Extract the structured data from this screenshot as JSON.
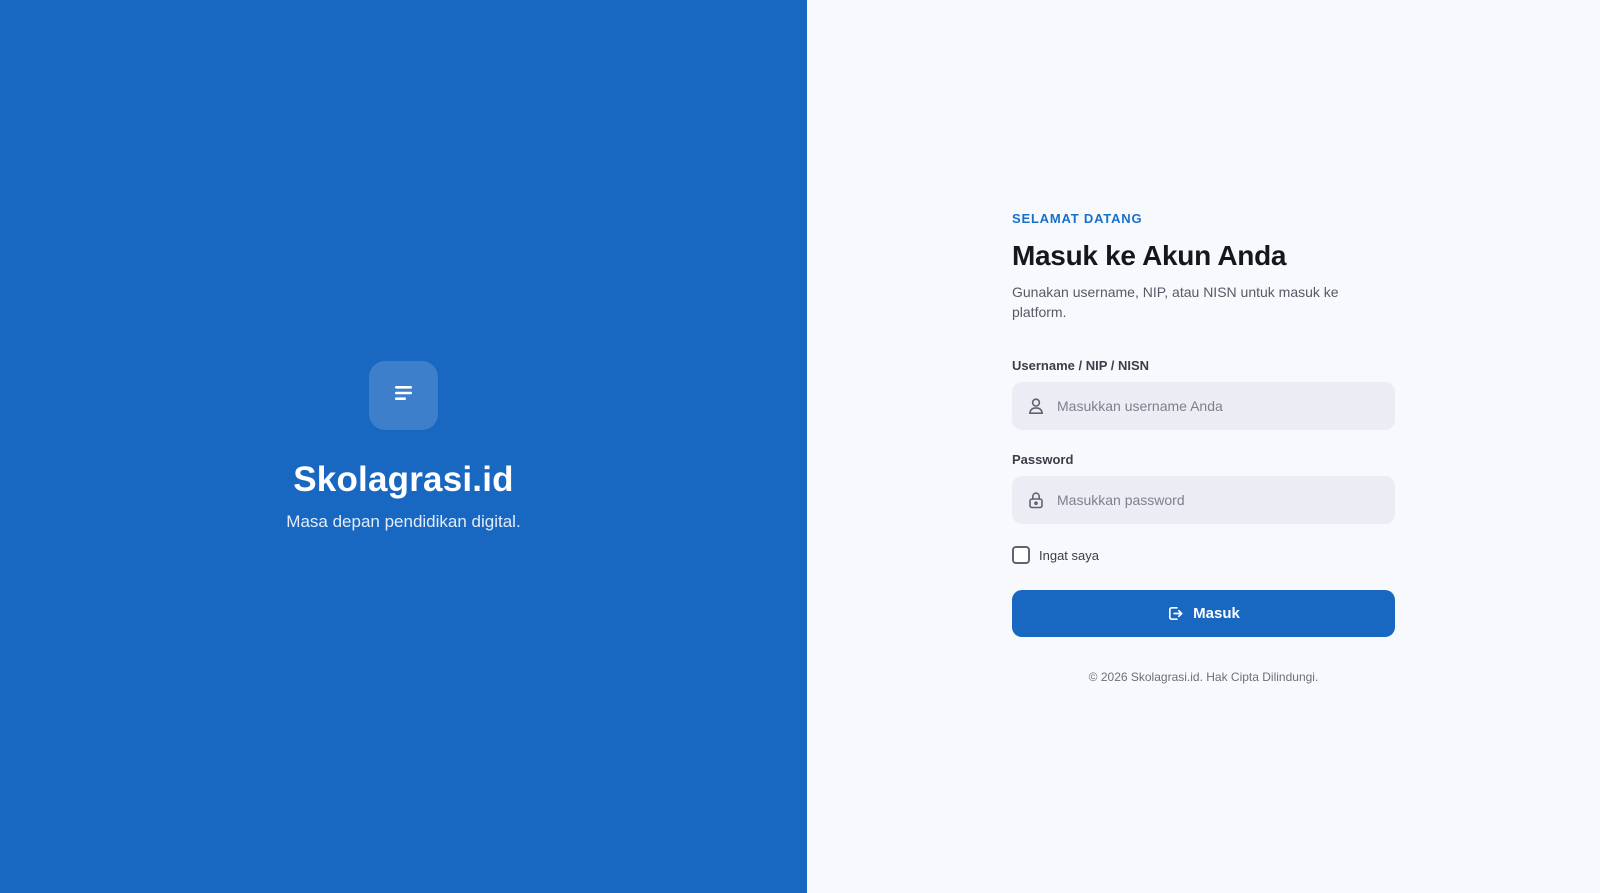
{
  "brand": {
    "name": "Skolagrasi.id",
    "tagline": "Masa depan pendidikan digital.",
    "logo_icon": "menu-lines-icon",
    "color": "#1867c0"
  },
  "form": {
    "eyebrow": "SELAMAT DATANG",
    "title": "Masuk ke Akun Anda",
    "subtitle": "Gunakan username, NIP, atau NISN untuk masuk ke platform.",
    "username": {
      "label": "Username / NIP / NISN",
      "placeholder": "Masukkan username Anda",
      "value": "",
      "icon": "user-icon"
    },
    "password": {
      "label": "Password",
      "placeholder": "Masukkan password",
      "value": "",
      "icon": "lock-icon"
    },
    "remember": {
      "label": "Ingat saya",
      "checked": false
    },
    "submit": {
      "label": "Masuk",
      "icon": "login-icon"
    }
  },
  "footer": {
    "text": "© 2026 Skolagrasi.id. Hak Cipta Dilindungi."
  },
  "colors": {
    "accent": "#1867c0",
    "eyebrow": "#1a6fc9",
    "input_bg": "#ecedf4",
    "panel_bg": "#f7f9fc"
  }
}
